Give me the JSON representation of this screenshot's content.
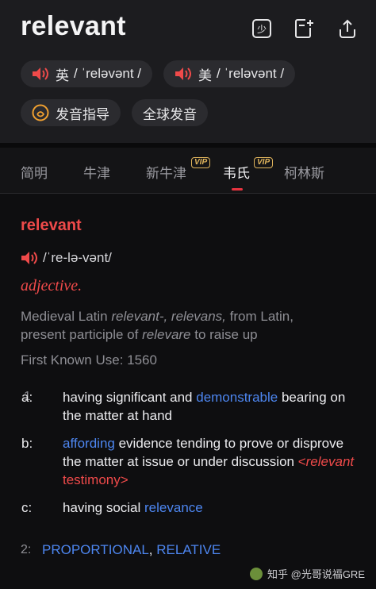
{
  "header": {
    "word": "relevant",
    "icons": [
      "study-icon",
      "add-note-icon",
      "share-icon"
    ],
    "pron_uk_label": "英",
    "pron_uk": "/ ˈreləvənt /",
    "pron_us_label": "美",
    "pron_us": "/ ˈreləvənt /",
    "guide_label": "发音指导",
    "global_label": "全球发音",
    "study_icon_glyph": "少"
  },
  "tabs": [
    {
      "label": "简明"
    },
    {
      "label": "牛津"
    },
    {
      "label": "新牛津",
      "badge": "VIP"
    },
    {
      "label": "韦氏",
      "badge": "VIP",
      "active": true
    },
    {
      "label": "柯林斯"
    }
  ],
  "entry": {
    "headword": "relevant",
    "pronunciation": "/ˈre-lə-vənt/",
    "pos": "adjective.",
    "etym_1": "Medieval Latin ",
    "etym_2": "relevant-, relevans,",
    "etym_3": " from Latin, present participle of ",
    "etym_4": "relevare",
    "etym_5": " to raise up",
    "first_use": "First Known Use: 1560",
    "sense1_num": "1",
    "sense1a_letter": "a:",
    "sense1a_text1": "having significant and ",
    "sense1a_link": "demonstrable",
    "sense1a_text2": " bearing on the matter at hand",
    "sense1b_letter": "b:",
    "sense1b_link": "affording",
    "sense1b_text1": " evidence tending to prove or disprove the matter at issue or under discussion ",
    "sense1b_ex_open": "<",
    "sense1b_ex_word": "relevant",
    "sense1b_ex_rest": " testimony>",
    "sense1c_letter": "c:",
    "sense1c_text1": "having social ",
    "sense1c_link": "relevance",
    "sense2_num": "2:",
    "sense2_link1": "PROPORTIONAL",
    "sense2_sep": ", ",
    "sense2_link2": "RELATIVE"
  },
  "watermark": {
    "text": "知乎 @光哥说福GRE"
  },
  "colors": {
    "accent_red": "#ef4a4a",
    "link_blue": "#4d86f0",
    "vip_gold": "#e0b45c"
  }
}
